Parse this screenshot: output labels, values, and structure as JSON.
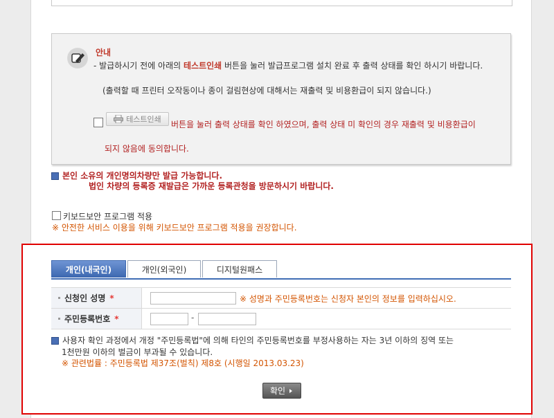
{
  "notice": {
    "title": "안내",
    "line1_pre": "- 발급하시기 전에 아래의 ",
    "line1_bold": "테스트인쇄",
    "line1_post": " 버튼을 눌러 발급프로그램 설치 완료 후 출력 상태를 확인 하시기 바랍니다.",
    "line2": "(출력할 때 프린터 오작동이나 종이 걸림현상에 대해서는 재출력 및 비용환급이 되지 않습니다.)",
    "test_print_label": "테스트인쇄",
    "agree_text": "버튼을 눌러 출력 상태를 확인 하였으며, 출력 상태 미 확인의 경우 재출력 및 비용환급이",
    "agree_text2": "되지 않음에 동의합니다."
  },
  "ownership": {
    "line1": "본인 소유의 개인명의차량만 발급 가능합니다.",
    "line2": "법인 차량의 등록증 재발급은 가까운 등록관청을 방문하시기 바랍니다."
  },
  "keyboard": {
    "label": "키보드보안 프로그램 적용",
    "note": "※ 안전한 서비스 이용을 위해 키보드보안 프로그램 적용을 권장합니다."
  },
  "tabs": [
    {
      "label": "개인(내국인)"
    },
    {
      "label": "개인(외국인)"
    },
    {
      "label": "디지털원패스"
    }
  ],
  "form": {
    "name_label": "신청인 성명",
    "name_hint": "※ 성명과 주민등록번호는 신청자 본인의 정보를 입력하십시오.",
    "rrn_label": "주민등록번호",
    "required_mark": "*",
    "dash": "-"
  },
  "warning": {
    "line1": "사용자 확인 과정에서 개정 \"주민등록법\"에 의해 타인의 주민등록번호를 부정사용하는 자는 3년 이하의 징역 또는",
    "line2": "1천만원 이하의 벌금이 부과될 수 있습니다.",
    "law": "※ 관련법률 : 주민등록법 제37조(벌칙) 제8호 (시행일 2013.03.23)"
  },
  "confirm_label": "확인",
  "colors": {
    "accent_red": "#e00000",
    "tab_blue": "#3c67b0",
    "warn_orange": "#d35400"
  }
}
